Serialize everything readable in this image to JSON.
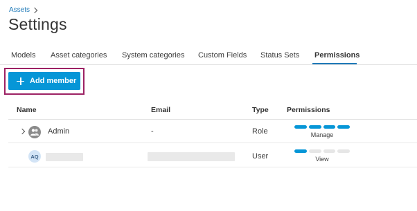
{
  "breadcrumb": {
    "label": "Assets"
  },
  "page": {
    "title": "Settings"
  },
  "tabs": [
    {
      "label": "Models"
    },
    {
      "label": "Asset categories"
    },
    {
      "label": "System categories"
    },
    {
      "label": "Custom Fields"
    },
    {
      "label": "Status Sets"
    },
    {
      "label": "Permissions",
      "active": true
    }
  ],
  "toolbar": {
    "add_member_label": "Add member"
  },
  "table": {
    "columns": [
      "Name",
      "Email",
      "Type",
      "Permissions"
    ],
    "rows": [
      {
        "avatar": "group-icon",
        "name": "Admin",
        "email": "-",
        "type": "Role",
        "permission": "Manage",
        "level": 4,
        "levels_total": 4
      },
      {
        "avatar_initials": "AQ",
        "name": "",
        "email": "",
        "type": "User",
        "permission": "View",
        "level": 1,
        "levels_total": 4
      }
    ]
  },
  "colors": {
    "accent": "#0696d7",
    "link": "#1f7ab8",
    "highlight": "#9c2163"
  }
}
